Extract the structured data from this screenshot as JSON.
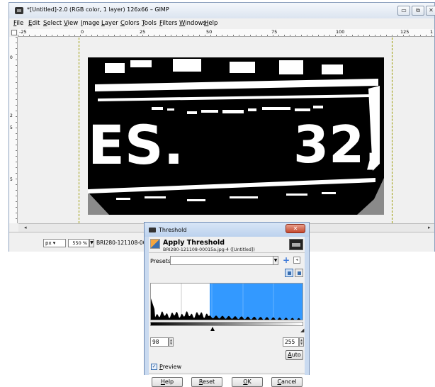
{
  "window": {
    "title": "*[Untitled]-2.0 (RGB color, 1 layer) 126x66 – GIMP",
    "min_glyph": "▭",
    "max_glyph": "⧉",
    "close_glyph": "✕"
  },
  "menu": [
    "File",
    "Edit",
    "Select",
    "View",
    "Image",
    "Layer",
    "Colors",
    "Tools",
    "Filters",
    "Windows",
    "Help"
  ],
  "rulers": {
    "top": [
      "-25",
      "0",
      "25",
      "50",
      "75",
      "100",
      "125",
      "1"
    ],
    "left": [
      "0",
      "2",
      "5",
      "5"
    ]
  },
  "plate": {
    "left_text": "ES.",
    "right_text": "32,"
  },
  "statusbar": {
    "unit": "px ▾",
    "zoom": "550 %",
    "file": "BRI280-121108-00015a.jpg ("
  },
  "threshold": {
    "window_title": "Threshold",
    "close_glyph": "✕",
    "header_title": "Apply Threshold",
    "header_subtitle": "BRI280-121108-00015a.jpg-4 ([Untitled])",
    "presets_label": "Presets:",
    "presets_value": "",
    "add_glyph": "+",
    "menu_glyph": "◂",
    "low_value": "98",
    "high_value": "255",
    "auto_label": "Auto",
    "preview_label": "Preview",
    "preview_checked": true,
    "buttons": {
      "help": "Help",
      "reset": "Reset",
      "ok": "OK",
      "cancel": "Cancel"
    },
    "histogram_low_fraction": 0.384,
    "colors": {
      "selection": "#3399ff",
      "histogram": "#000000"
    }
  }
}
